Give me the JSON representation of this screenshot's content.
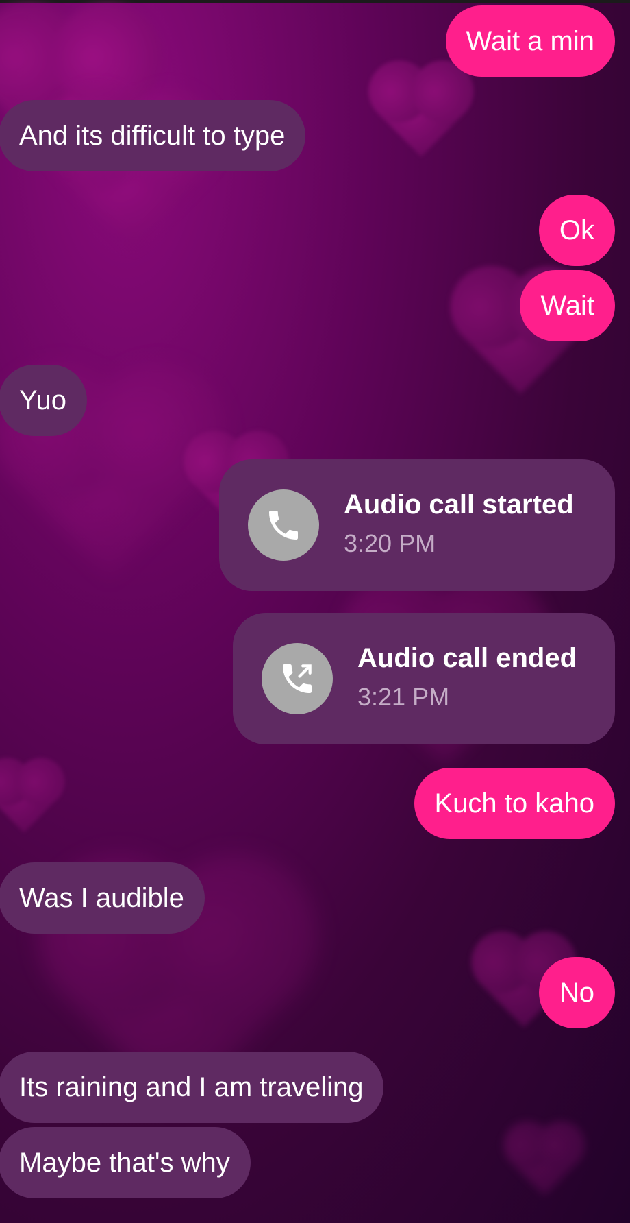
{
  "colors": {
    "sent_bubble": "#ff1f8c",
    "received_bubble": "#5f2a62",
    "call_card": "#5f2a62",
    "call_icon_circle": "#a9a9a9"
  },
  "messages": [
    {
      "direction": "sent",
      "text": "Wait a min"
    },
    {
      "direction": "received",
      "text": "And its difficult to type"
    },
    {
      "direction": "sent",
      "text": "Ok"
    },
    {
      "direction": "sent",
      "text": "Wait"
    },
    {
      "direction": "received",
      "text": "Yuo"
    },
    {
      "direction": "sent",
      "text": "Kuch to kaho"
    },
    {
      "direction": "received",
      "text": "Was I audible"
    },
    {
      "direction": "sent",
      "text": "No"
    },
    {
      "direction": "received",
      "text": "Its raining and I am traveling"
    },
    {
      "direction": "received",
      "text": "Maybe that's why"
    }
  ],
  "calls": [
    {
      "title": "Audio call started",
      "time": "3:20 PM",
      "icon": "phone-icon"
    },
    {
      "title": "Audio call ended",
      "time": "3:21 PM",
      "icon": "phone-outgoing-icon"
    }
  ]
}
